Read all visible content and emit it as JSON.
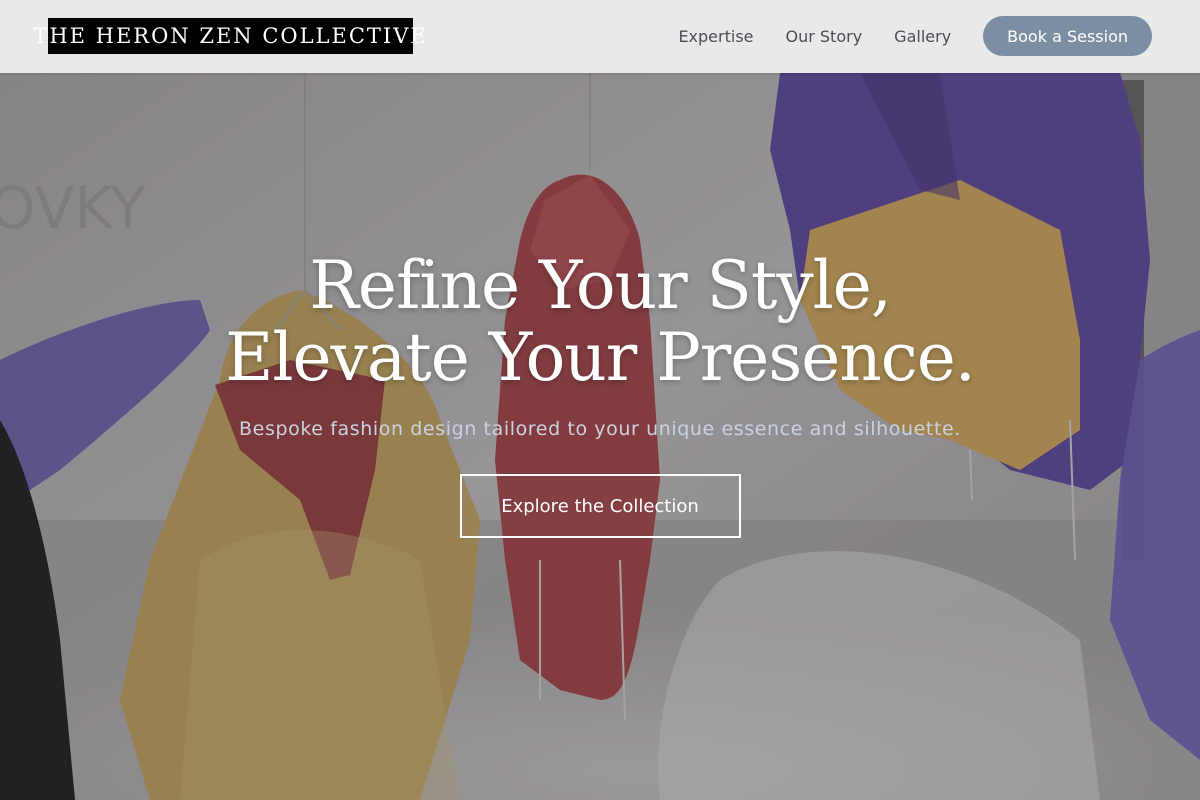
{
  "header": {
    "logo_text": "THE HERON ZEN COLLECTIVE",
    "nav": [
      {
        "label": "Expertise"
      },
      {
        "label": "Our Story"
      },
      {
        "label": "Gallery"
      }
    ],
    "cta_label": "Book a Session"
  },
  "hero": {
    "headline_line1": "Refine Your Style,",
    "headline_line2": "Elevate Your Presence.",
    "subheadline": "Bespoke fashion design tailored to your unique essence and silhouette.",
    "button_label": "Explore the Collection",
    "background_description_colors": {
      "overlay": "#6f6c6c",
      "mustard": "#c9a256",
      "crimson": "#9b3a3c",
      "violet": "#5d4aa0"
    }
  }
}
